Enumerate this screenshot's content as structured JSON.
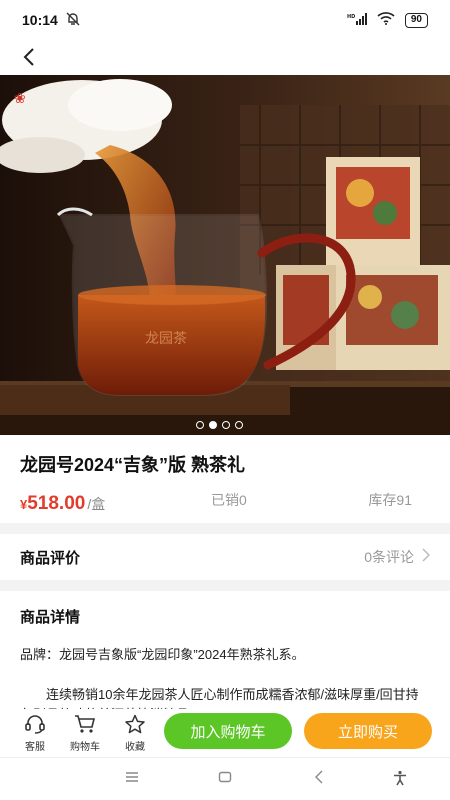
{
  "status_bar": {
    "time": "10:14",
    "signal": "HD",
    "battery": "90"
  },
  "nav": {
    "back_icon": "chevron-left-icon"
  },
  "hero": {
    "slide_count": 4,
    "active_slide": 1
  },
  "product": {
    "title": "龙园号2024“吉象”版 熟茶礼",
    "price_symbol": "¥",
    "price": "518.00",
    "unit": "/盒",
    "sold": "已销0",
    "stock": "库存91"
  },
  "reviews": {
    "title": "商品评价",
    "count_text": "0条评论"
  },
  "detail": {
    "title": "商品详情",
    "brand_line": "品牌：龙园号吉象版“龙园印象”2024年熟茶礼系。",
    "body": "连续畅销10余年龙园茶人匠心制作而成糯香浓郁/滋味厚重/回甘持久别具韵味的普洱茶快消精品"
  },
  "bottom_bar": {
    "service": "客服",
    "cart": "购物车",
    "favorite": "收藏",
    "add_to_cart": "加入购物车",
    "buy_now": "立即购买"
  },
  "colors": {
    "price": "#e23c2c",
    "cart_button": "#5cc627",
    "buy_button": "#f8a51c"
  }
}
